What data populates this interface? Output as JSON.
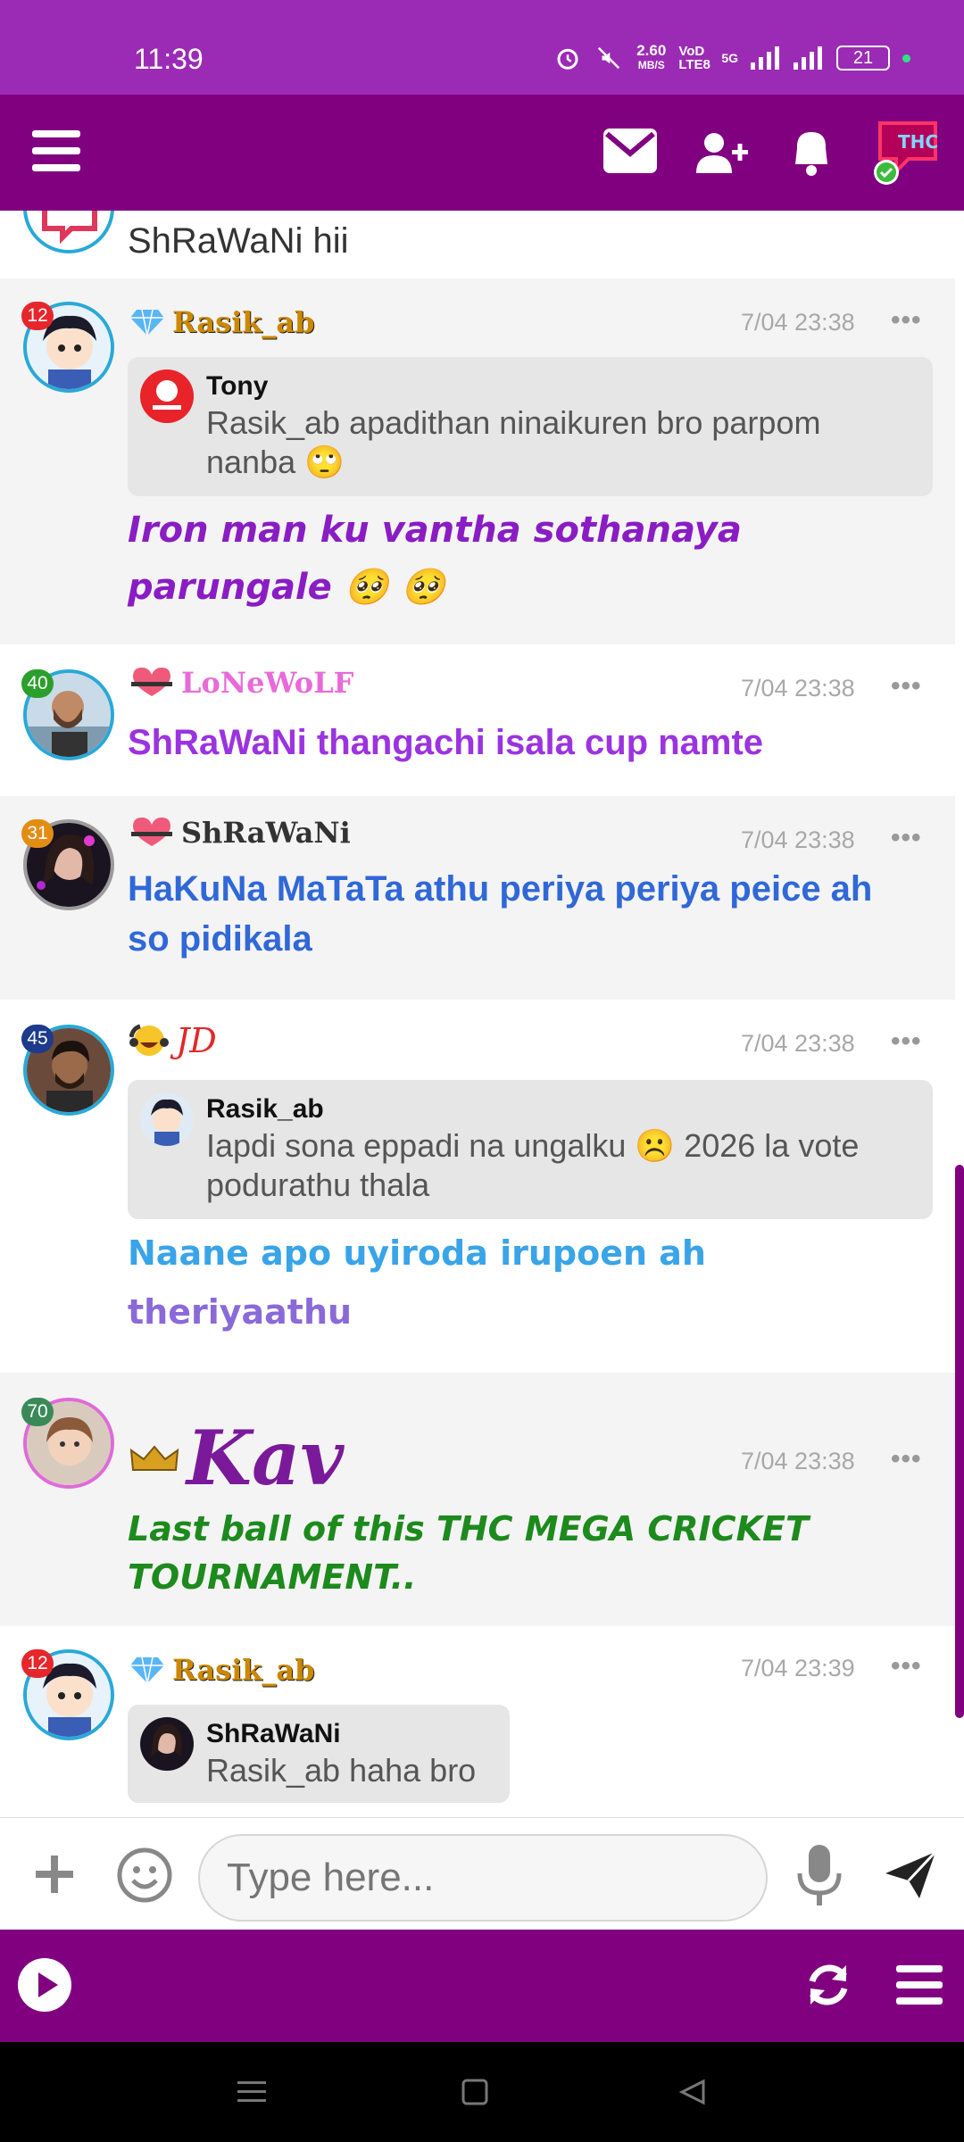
{
  "status_bar": {
    "time": "11:39",
    "speed_value": "2.60",
    "speed_unit": "MB/S",
    "network_tag": "VoD LTE8",
    "network_5g": "5G",
    "battery": "21"
  },
  "colors": {
    "status_bar_bg": "#9b2bb5",
    "header_bg": "#800080",
    "bottom_bar_bg": "#800080"
  },
  "header": {
    "icons": [
      "menu-icon",
      "envelope-icon",
      "add-user-icon",
      "bell-icon",
      "profile-avatar"
    ]
  },
  "messages": [
    {
      "text": "ShRaWaNi hii"
    },
    {
      "badge": "12",
      "username": "Rasik_ab",
      "timestamp": "7/04 23:38",
      "more": "•••",
      "quote": {
        "name": "Tony",
        "text": "Rasik_ab apadithan ninaikuren bro parpom nanba 🙄"
      },
      "text": "Iron man ku vantha sothanaya parungale 🥺 🥺"
    },
    {
      "badge": "40",
      "username": "LoNeWoLF",
      "timestamp": "7/04 23:38",
      "more": "•••",
      "text": "ShRaWaNi thangachi isala cup namte"
    },
    {
      "badge": "31",
      "username": "ShRaWaNi",
      "timestamp": "7/04 23:38",
      "more": "•••",
      "text": "HaKuNa MaTaTa athu periya periya peice ah so pidikala"
    },
    {
      "badge": "45",
      "username": "JD",
      "timestamp": "7/04 23:38",
      "more": "•••",
      "quote": {
        "name": "Rasik_ab",
        "text": "Iapdi sona eppadi na ungalku ☹️ 2026 la vote podurathu thala"
      },
      "text_line1": "Naane apo uyiroda irupoen ah",
      "text_line2": "theriyaathu"
    },
    {
      "badge": "70",
      "username": "Kav",
      "timestamp": "7/04 23:38",
      "more": "•••",
      "text": "Last ball of this THC MEGA CRICKET TOURNAMENT.."
    },
    {
      "badge": "12",
      "username": "Rasik_ab",
      "timestamp": "7/04 23:39",
      "more": "•••",
      "quote": {
        "name": "ShRaWaNi",
        "text": "Rasik_ab haha bro"
      }
    }
  ],
  "input_bar": {
    "placeholder": "Type here..."
  }
}
